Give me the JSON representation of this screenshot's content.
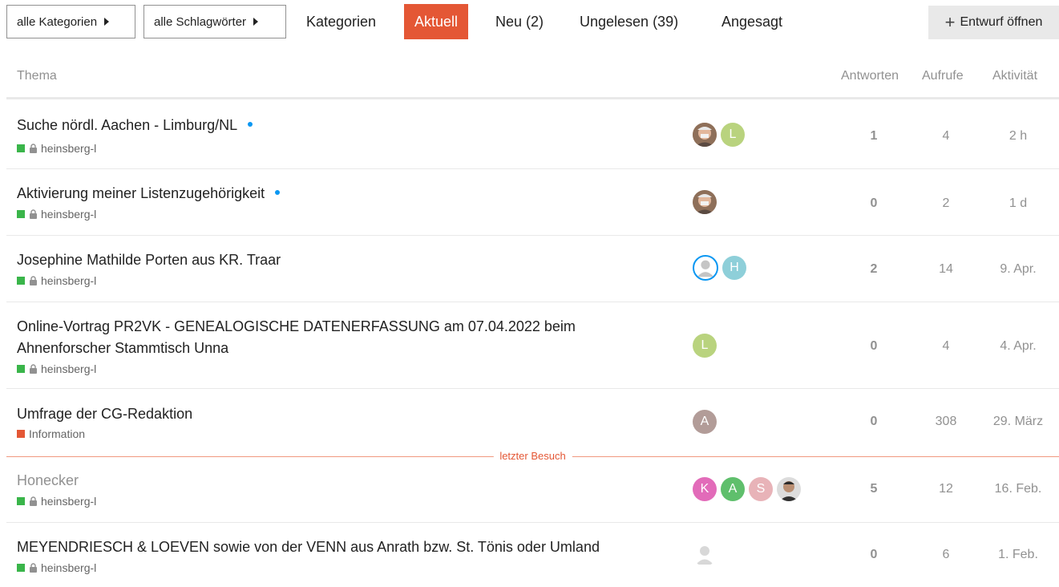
{
  "nav": {
    "categories_dropdown": "alle Kategorien",
    "tags_dropdown": "alle Schlagwörter",
    "links": [
      {
        "label": "Kategorien",
        "active": false
      },
      {
        "label": "Aktuell",
        "active": true
      },
      {
        "label": "Neu (2)",
        "active": false
      },
      {
        "label": "Ungelesen (39)",
        "active": false
      },
      {
        "label": "Angesagt",
        "active": false
      }
    ],
    "draft_button": "Entwurf öffnen",
    "draft_icon": "plus-icon"
  },
  "columns": {
    "topic": "Thema",
    "replies": "Antworten",
    "views": "Aufrufe",
    "activity": "Aktivität"
  },
  "topics": [
    {
      "title": "Suche nördl. Aachen - Limburg/NL",
      "unread_dot": true,
      "category": "heinsberg-l",
      "category_color": "#3ab54a",
      "locked": true,
      "posters": [
        {
          "type": "photo-icon",
          "letter": ""
        },
        {
          "type": "letter",
          "letter": "L",
          "color": "#b9d37e"
        }
      ],
      "replies": "1",
      "views": "4",
      "activity": "2 h"
    },
    {
      "title": "Aktivierung meiner Listenzugehörigkeit",
      "unread_dot": true,
      "category": "heinsberg-l",
      "category_color": "#3ab54a",
      "locked": true,
      "posters": [
        {
          "type": "photo-icon",
          "letter": ""
        }
      ],
      "replies": "0",
      "views": "2",
      "activity": "1 d"
    },
    {
      "title": "Josephine Mathilde Porten aus KR. Traar",
      "unread_dot": false,
      "category": "heinsberg-l",
      "category_color": "#3ab54a",
      "locked": true,
      "posters": [
        {
          "type": "default-avatar-icon",
          "letter": ""
        },
        {
          "type": "letter",
          "letter": "H",
          "color": "#8ecfd9"
        }
      ],
      "replies": "2",
      "views": "14",
      "activity": "9. Apr."
    },
    {
      "title_line1": "Online-Vortrag PR2VK - GENEALOGISCHE DATENERFASSUNG am 07.04.2022 beim",
      "title_line2": "Ahnenforscher Stammtisch Unna",
      "unread_dot": false,
      "category": "heinsberg-l",
      "category_color": "#3ab54a",
      "locked": true,
      "posters": [
        {
          "type": "letter",
          "letter": "L",
          "color": "#b9d37e"
        }
      ],
      "replies": "0",
      "views": "4",
      "activity": "4. Apr."
    },
    {
      "title": "Umfrage der CG-Redaktion",
      "unread_dot": false,
      "category": "Information",
      "category_color": "#e45735",
      "locked": false,
      "posters": [
        {
          "type": "letter",
          "letter": "A",
          "color": "#b29c98"
        }
      ],
      "replies": "0",
      "views": "308",
      "activity": "29. März"
    },
    {
      "title": "Honecker",
      "unread_dot": false,
      "category": "heinsberg-l",
      "category_color": "#3ab54a",
      "locked": true,
      "posters": [
        {
          "type": "letter",
          "letter": "K",
          "color": "#e26bb9"
        },
        {
          "type": "letter",
          "letter": "A",
          "color": "#5fbf6c"
        },
        {
          "type": "letter",
          "letter": "S",
          "color": "#e8b3b8"
        },
        {
          "type": "photo-icon",
          "letter": ""
        }
      ],
      "replies": "5",
      "views": "12",
      "activity": "16. Feb."
    },
    {
      "title": "MEYENDRIESCH & LOEVEN sowie von der VENN aus Anrath bzw. St. Tönis oder Umland",
      "unread_dot": false,
      "category": "heinsberg-l",
      "category_color": "#3ab54a",
      "locked": true,
      "posters": [
        {
          "type": "default-avatar-icon",
          "letter": ""
        }
      ],
      "replies": "0",
      "views": "6",
      "activity": "1. Feb."
    }
  ],
  "last_visit_label": "letzter Besuch"
}
